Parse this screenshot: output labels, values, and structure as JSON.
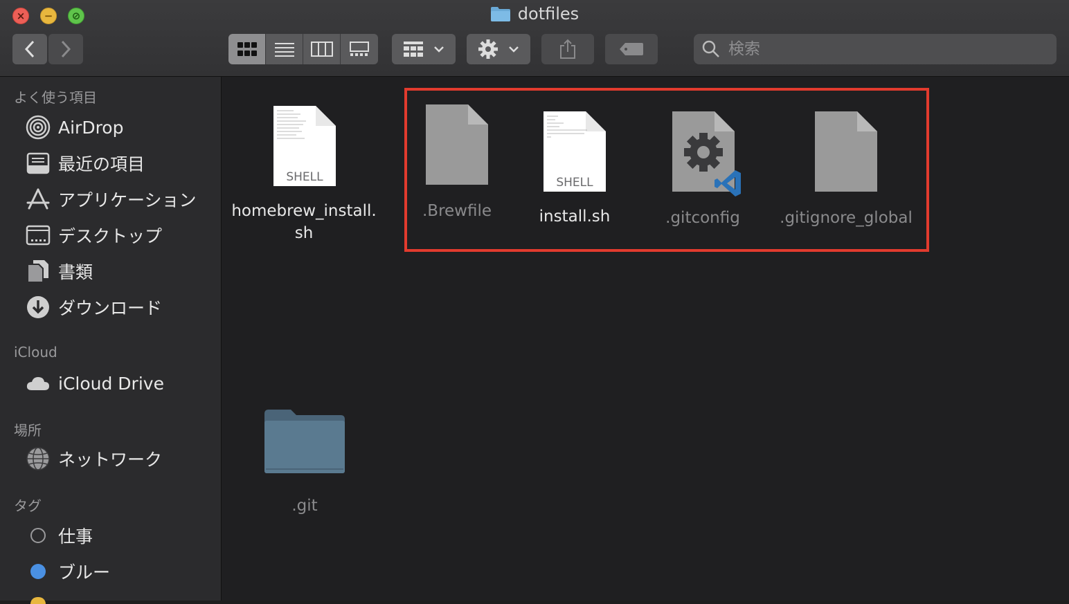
{
  "window": {
    "title": "dotfiles"
  },
  "toolbar": {
    "back_icon": "chevron-left-icon",
    "forward_icon": "chevron-right-icon",
    "view_modes": [
      "icon-view",
      "list-view",
      "column-view",
      "gallery-view"
    ],
    "active_view": "icon-view",
    "search_placeholder": "検索"
  },
  "sidebar": {
    "favorites_title": "よく使う項目",
    "favorites": [
      {
        "label": "AirDrop",
        "icon": "airdrop-icon"
      },
      {
        "label": "最近の項目",
        "icon": "recents-icon"
      },
      {
        "label": "アプリケーション",
        "icon": "applications-icon"
      },
      {
        "label": "デスクトップ",
        "icon": "desktop-icon"
      },
      {
        "label": "書類",
        "icon": "documents-icon"
      },
      {
        "label": "ダウンロード",
        "icon": "downloads-icon"
      }
    ],
    "icloud_title": "iCloud",
    "icloud": [
      {
        "label": "iCloud Drive",
        "icon": "icloud-icon"
      }
    ],
    "locations_title": "場所",
    "locations": [
      {
        "label": "ネットワーク",
        "icon": "network-icon"
      }
    ],
    "tags_title": "タグ",
    "tags": [
      {
        "label": "仕事",
        "color": "#3a3a3c"
      },
      {
        "label": "ブルー",
        "color": "#4a90e2"
      }
    ]
  },
  "files": [
    {
      "name_line1": "homebrew_install.",
      "name_line2": "sh",
      "type_label": "SHELL",
      "hidden": false
    },
    {
      "name": ".Brewfile",
      "hidden": true
    },
    {
      "name": "install.sh",
      "type_label": "SHELL",
      "hidden": false
    },
    {
      "name": ".gitconfig",
      "hidden": true
    },
    {
      "name": ".gitignore_global",
      "hidden": true
    },
    {
      "name": ".git",
      "hidden": true
    }
  ],
  "colors": {
    "highlight": "#e23b2e",
    "folder": "#5a7a90"
  }
}
